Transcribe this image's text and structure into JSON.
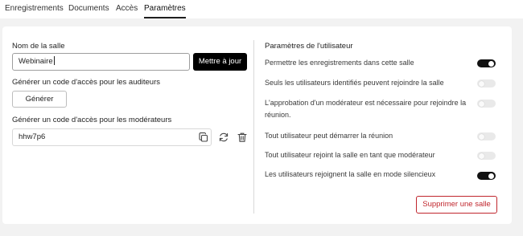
{
  "tabs": [
    {
      "label": "Enregistrements",
      "active": false
    },
    {
      "label": "Documents",
      "active": false
    },
    {
      "label": "Accès",
      "active": false
    },
    {
      "label": "Paramètres",
      "active": true
    }
  ],
  "room": {
    "name_label": "Nom de la salle",
    "name_value": "Webinaire",
    "update_button": "Mettre à jour"
  },
  "viewer_code": {
    "label": "Générer un code d'accès pour les auditeurs",
    "generate_button": "Générer"
  },
  "moderator_code": {
    "label": "Générer un code d'accès pour les modérateurs",
    "value": "hhw7p6"
  },
  "user_settings": {
    "title": "Paramètres de l'utilisateur",
    "items": [
      {
        "label": "Permettre les enregistrements dans cette salle",
        "enabled": true
      },
      {
        "label": "Seuls les utilisateurs identifiés peuvent rejoindre la salle",
        "enabled": false
      },
      {
        "label": "L'approbation d'un modérateur est nécessaire pour rejoindre la réunion.",
        "enabled": false
      },
      {
        "label": "Tout utilisateur peut démarrer la réunion",
        "enabled": false
      },
      {
        "label": "Tout utilisateur rejoint la salle en tant que modérateur",
        "enabled": false
      },
      {
        "label": "Les utilisateurs rejoignent la salle en mode silencieux",
        "enabled": true
      }
    ]
  },
  "delete_button": "Supprimer une salle",
  "colors": {
    "accent": "#000000",
    "danger": "#c0262d"
  }
}
